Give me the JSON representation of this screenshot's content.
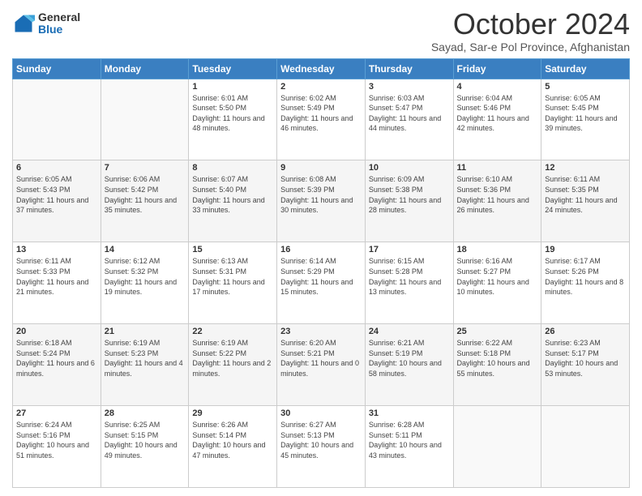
{
  "header": {
    "logo_general": "General",
    "logo_blue": "Blue",
    "month": "October 2024",
    "location": "Sayad, Sar-e Pol Province, Afghanistan"
  },
  "weekdays": [
    "Sunday",
    "Monday",
    "Tuesday",
    "Wednesday",
    "Thursday",
    "Friday",
    "Saturday"
  ],
  "weeks": [
    [
      {
        "day": "",
        "sunrise": "",
        "sunset": "",
        "daylight": ""
      },
      {
        "day": "",
        "sunrise": "",
        "sunset": "",
        "daylight": ""
      },
      {
        "day": "1",
        "sunrise": "Sunrise: 6:01 AM",
        "sunset": "Sunset: 5:50 PM",
        "daylight": "Daylight: 11 hours and 48 minutes."
      },
      {
        "day": "2",
        "sunrise": "Sunrise: 6:02 AM",
        "sunset": "Sunset: 5:49 PM",
        "daylight": "Daylight: 11 hours and 46 minutes."
      },
      {
        "day": "3",
        "sunrise": "Sunrise: 6:03 AM",
        "sunset": "Sunset: 5:47 PM",
        "daylight": "Daylight: 11 hours and 44 minutes."
      },
      {
        "day": "4",
        "sunrise": "Sunrise: 6:04 AM",
        "sunset": "Sunset: 5:46 PM",
        "daylight": "Daylight: 11 hours and 42 minutes."
      },
      {
        "day": "5",
        "sunrise": "Sunrise: 6:05 AM",
        "sunset": "Sunset: 5:45 PM",
        "daylight": "Daylight: 11 hours and 39 minutes."
      }
    ],
    [
      {
        "day": "6",
        "sunrise": "Sunrise: 6:05 AM",
        "sunset": "Sunset: 5:43 PM",
        "daylight": "Daylight: 11 hours and 37 minutes."
      },
      {
        "day": "7",
        "sunrise": "Sunrise: 6:06 AM",
        "sunset": "Sunset: 5:42 PM",
        "daylight": "Daylight: 11 hours and 35 minutes."
      },
      {
        "day": "8",
        "sunrise": "Sunrise: 6:07 AM",
        "sunset": "Sunset: 5:40 PM",
        "daylight": "Daylight: 11 hours and 33 minutes."
      },
      {
        "day": "9",
        "sunrise": "Sunrise: 6:08 AM",
        "sunset": "Sunset: 5:39 PM",
        "daylight": "Daylight: 11 hours and 30 minutes."
      },
      {
        "day": "10",
        "sunrise": "Sunrise: 6:09 AM",
        "sunset": "Sunset: 5:38 PM",
        "daylight": "Daylight: 11 hours and 28 minutes."
      },
      {
        "day": "11",
        "sunrise": "Sunrise: 6:10 AM",
        "sunset": "Sunset: 5:36 PM",
        "daylight": "Daylight: 11 hours and 26 minutes."
      },
      {
        "day": "12",
        "sunrise": "Sunrise: 6:11 AM",
        "sunset": "Sunset: 5:35 PM",
        "daylight": "Daylight: 11 hours and 24 minutes."
      }
    ],
    [
      {
        "day": "13",
        "sunrise": "Sunrise: 6:11 AM",
        "sunset": "Sunset: 5:33 PM",
        "daylight": "Daylight: 11 hours and 21 minutes."
      },
      {
        "day": "14",
        "sunrise": "Sunrise: 6:12 AM",
        "sunset": "Sunset: 5:32 PM",
        "daylight": "Daylight: 11 hours and 19 minutes."
      },
      {
        "day": "15",
        "sunrise": "Sunrise: 6:13 AM",
        "sunset": "Sunset: 5:31 PM",
        "daylight": "Daylight: 11 hours and 17 minutes."
      },
      {
        "day": "16",
        "sunrise": "Sunrise: 6:14 AM",
        "sunset": "Sunset: 5:29 PM",
        "daylight": "Daylight: 11 hours and 15 minutes."
      },
      {
        "day": "17",
        "sunrise": "Sunrise: 6:15 AM",
        "sunset": "Sunset: 5:28 PM",
        "daylight": "Daylight: 11 hours and 13 minutes."
      },
      {
        "day": "18",
        "sunrise": "Sunrise: 6:16 AM",
        "sunset": "Sunset: 5:27 PM",
        "daylight": "Daylight: 11 hours and 10 minutes."
      },
      {
        "day": "19",
        "sunrise": "Sunrise: 6:17 AM",
        "sunset": "Sunset: 5:26 PM",
        "daylight": "Daylight: 11 hours and 8 minutes."
      }
    ],
    [
      {
        "day": "20",
        "sunrise": "Sunrise: 6:18 AM",
        "sunset": "Sunset: 5:24 PM",
        "daylight": "Daylight: 11 hours and 6 minutes."
      },
      {
        "day": "21",
        "sunrise": "Sunrise: 6:19 AM",
        "sunset": "Sunset: 5:23 PM",
        "daylight": "Daylight: 11 hours and 4 minutes."
      },
      {
        "day": "22",
        "sunrise": "Sunrise: 6:19 AM",
        "sunset": "Sunset: 5:22 PM",
        "daylight": "Daylight: 11 hours and 2 minutes."
      },
      {
        "day": "23",
        "sunrise": "Sunrise: 6:20 AM",
        "sunset": "Sunset: 5:21 PM",
        "daylight": "Daylight: 11 hours and 0 minutes."
      },
      {
        "day": "24",
        "sunrise": "Sunrise: 6:21 AM",
        "sunset": "Sunset: 5:19 PM",
        "daylight": "Daylight: 10 hours and 58 minutes."
      },
      {
        "day": "25",
        "sunrise": "Sunrise: 6:22 AM",
        "sunset": "Sunset: 5:18 PM",
        "daylight": "Daylight: 10 hours and 55 minutes."
      },
      {
        "day": "26",
        "sunrise": "Sunrise: 6:23 AM",
        "sunset": "Sunset: 5:17 PM",
        "daylight": "Daylight: 10 hours and 53 minutes."
      }
    ],
    [
      {
        "day": "27",
        "sunrise": "Sunrise: 6:24 AM",
        "sunset": "Sunset: 5:16 PM",
        "daylight": "Daylight: 10 hours and 51 minutes."
      },
      {
        "day": "28",
        "sunrise": "Sunrise: 6:25 AM",
        "sunset": "Sunset: 5:15 PM",
        "daylight": "Daylight: 10 hours and 49 minutes."
      },
      {
        "day": "29",
        "sunrise": "Sunrise: 6:26 AM",
        "sunset": "Sunset: 5:14 PM",
        "daylight": "Daylight: 10 hours and 47 minutes."
      },
      {
        "day": "30",
        "sunrise": "Sunrise: 6:27 AM",
        "sunset": "Sunset: 5:13 PM",
        "daylight": "Daylight: 10 hours and 45 minutes."
      },
      {
        "day": "31",
        "sunrise": "Sunrise: 6:28 AM",
        "sunset": "Sunset: 5:11 PM",
        "daylight": "Daylight: 10 hours and 43 minutes."
      },
      {
        "day": "",
        "sunrise": "",
        "sunset": "",
        "daylight": ""
      },
      {
        "day": "",
        "sunrise": "",
        "sunset": "",
        "daylight": ""
      }
    ]
  ]
}
